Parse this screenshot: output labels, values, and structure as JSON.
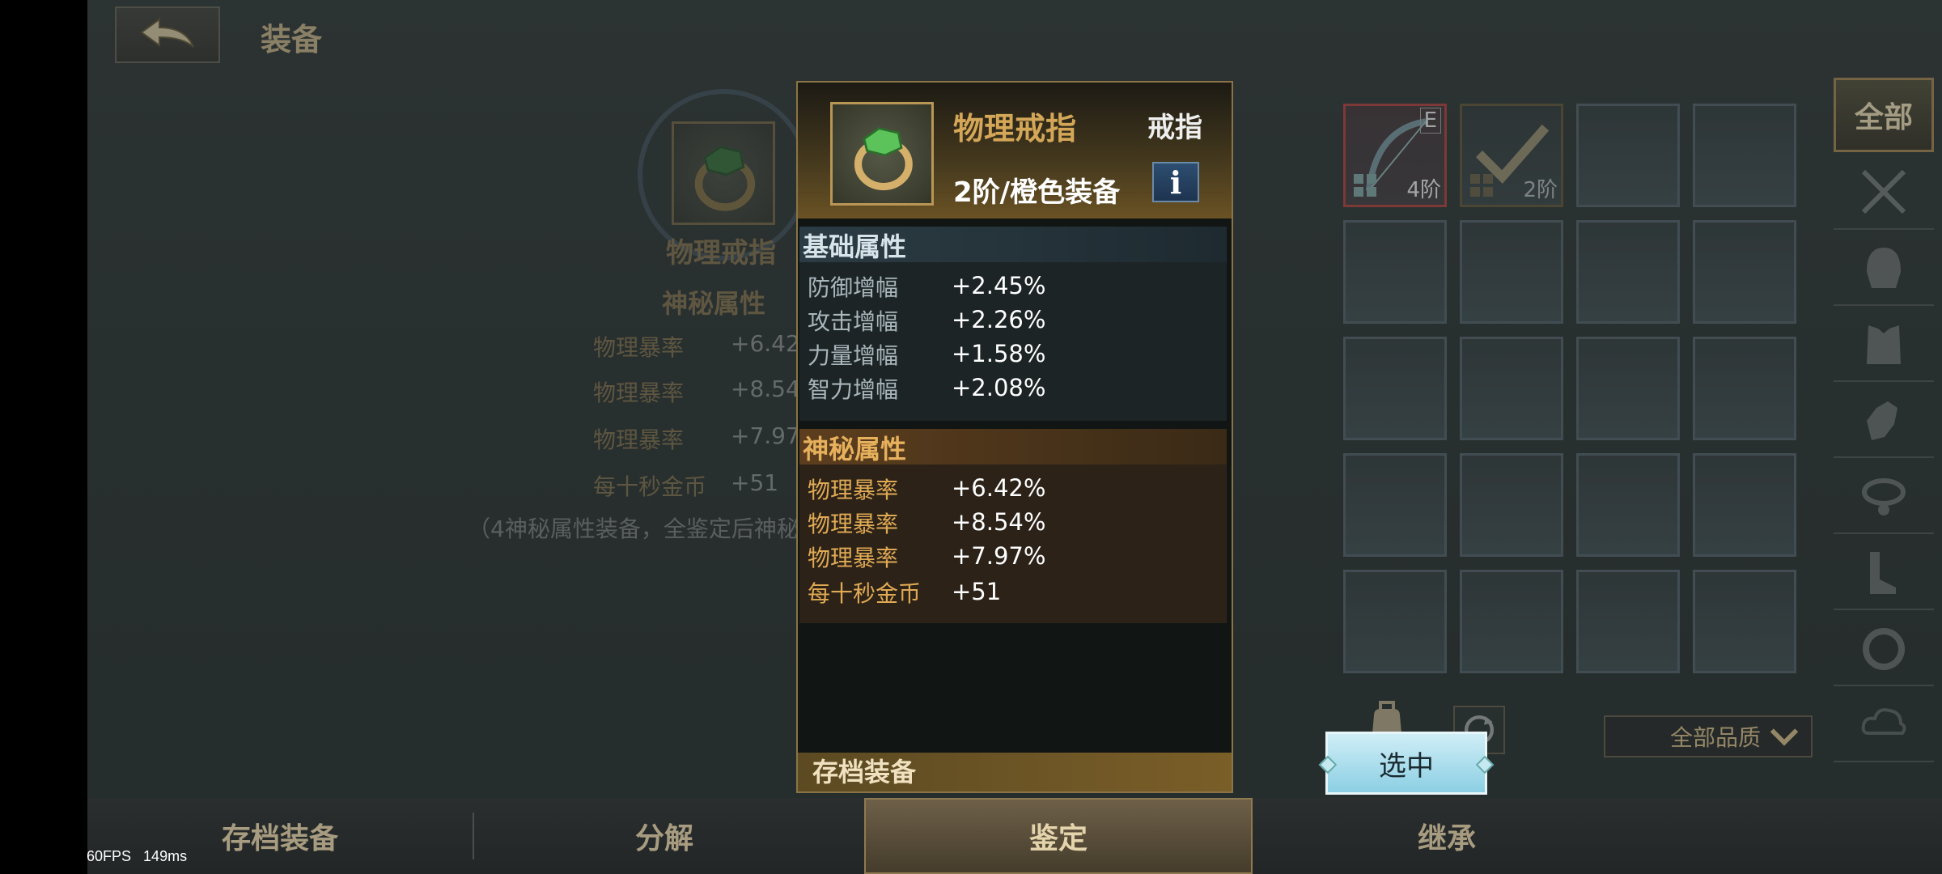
{
  "header": {
    "title": "装备"
  },
  "left_detail": {
    "item_name": "物理戒指",
    "mystic_header": "神秘属性",
    "rows": [
      {
        "name": "物理暴率",
        "value": "+6.42%"
      },
      {
        "name": "物理暴率",
        "value": "+8.54%"
      },
      {
        "name": "物理暴率",
        "value": "+7.97%"
      },
      {
        "name": "每十秒金币",
        "value": "+51"
      }
    ],
    "note": "（4神秘属性装备，全鉴定后神秘"
  },
  "popup": {
    "name": "物理戒指",
    "type": "戒指",
    "tier": "2阶/橙色装备",
    "info_label": "i",
    "base_header": "基础属性",
    "base_attrs": [
      {
        "name": "防御增幅",
        "value": "+2.45%"
      },
      {
        "name": "攻击增幅",
        "value": "+2.26%"
      },
      {
        "name": "力量增幅",
        "value": "+1.58%"
      },
      {
        "name": "智力增幅",
        "value": "+2.08%"
      }
    ],
    "mystic_header": "神秘属性",
    "mystic_attrs": [
      {
        "name": "物理暴率",
        "value": "+6.42%"
      },
      {
        "name": "物理暴率",
        "value": "+8.54%"
      },
      {
        "name": "物理暴率",
        "value": "+7.97%"
      },
      {
        "name": "每十秒金币",
        "value": "+51"
      }
    ],
    "footer": "存档装备"
  },
  "select_button": "选中",
  "bag": {
    "slot1": {
      "badge": "E",
      "tier": "4阶"
    },
    "slot2": {
      "tier": "2阶"
    }
  },
  "category_all": "全部",
  "quality_filter": "全部品质",
  "tabs": [
    "存档装备",
    "分解",
    "鉴定",
    "继承"
  ],
  "active_tab": "鉴定",
  "perf": {
    "fps": "60FPS",
    "latency": "149ms"
  },
  "colors": {
    "accent_gold": "#d4a758",
    "select_blue": "#8ccfe4",
    "rare_red": "#b54848"
  }
}
